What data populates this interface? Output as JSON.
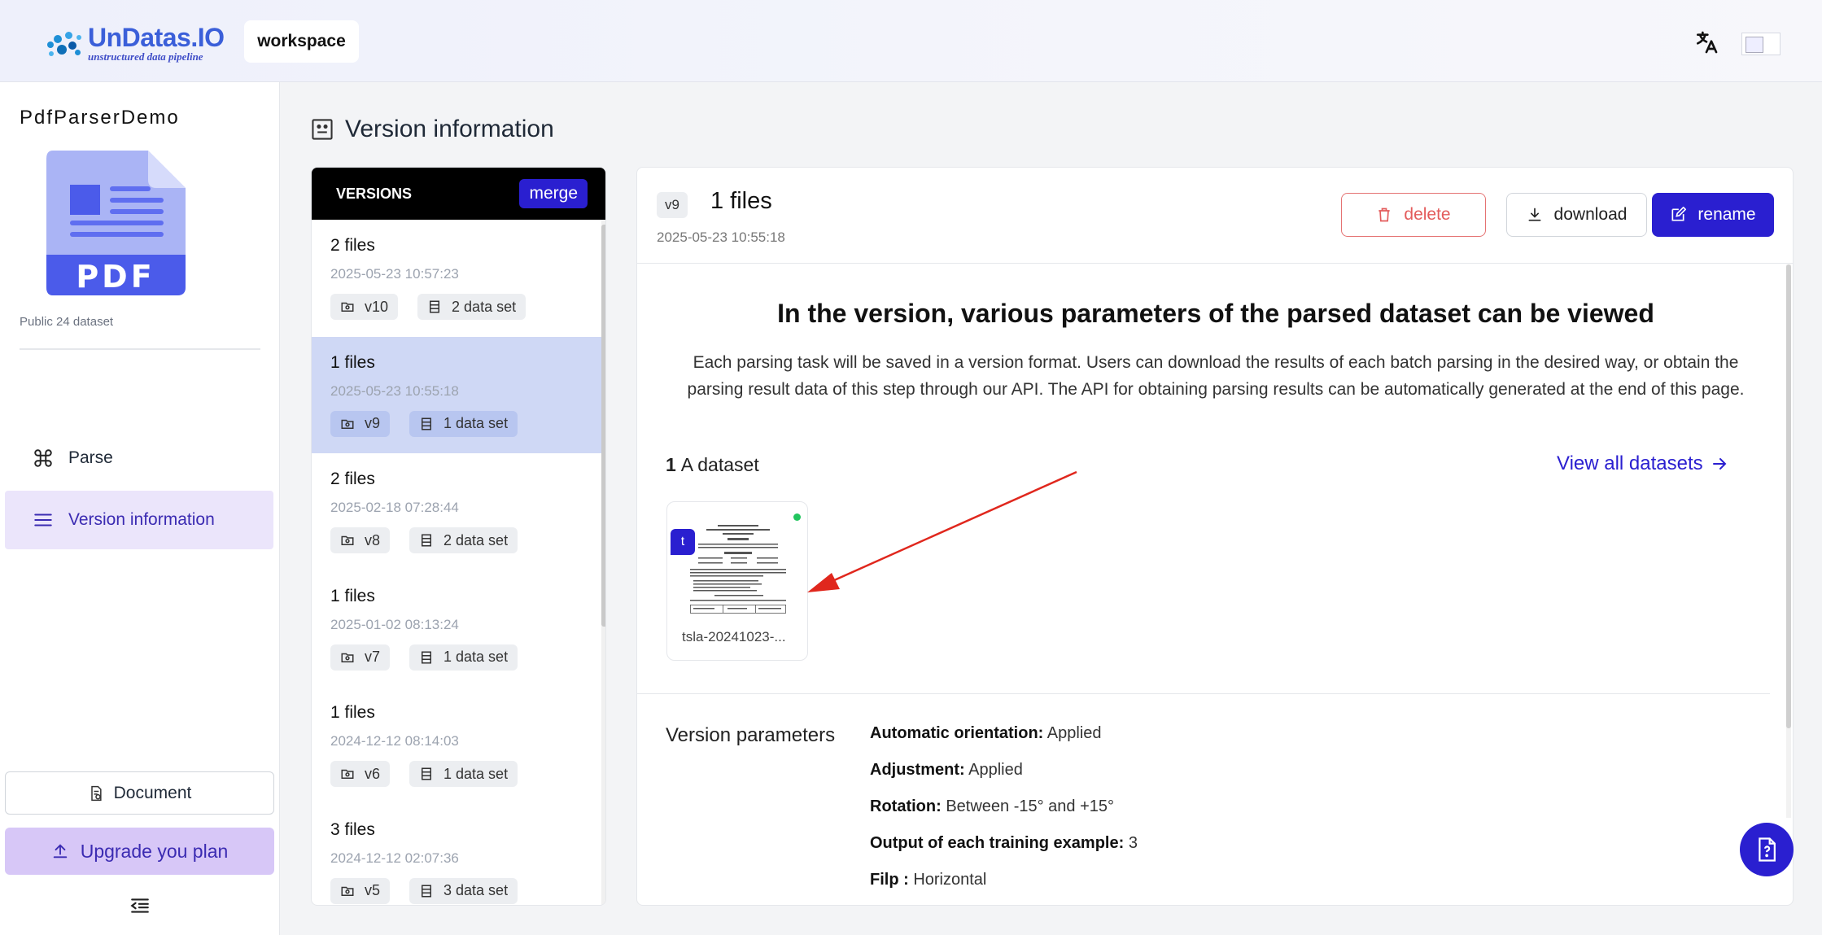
{
  "header": {
    "logo_title": "UnDatas.IO",
    "logo_subtitle": "unstructured data pipeline",
    "workspace_label": "workspace"
  },
  "sidebar": {
    "project_name": "PdfParserDemo",
    "pdf_label": "PDF",
    "public_text": "Public 24 dataset",
    "nav": [
      {
        "label": "Parse",
        "icon": "command-icon"
      },
      {
        "label": "Version information",
        "icon": "menu-icon",
        "active": true
      }
    ],
    "document_label": "Document",
    "upgrade_label": "Upgrade you plan"
  },
  "page": {
    "title": "Version information"
  },
  "versions": {
    "header_label": "VERSIONS",
    "merge_label": "merge",
    "items": [
      {
        "files": "2 files",
        "date": "2025-05-23 10:57:23",
        "version": "v10",
        "datasets": "2 data set",
        "selected": false
      },
      {
        "files": "1 files",
        "date": "2025-05-23 10:55:18",
        "version": "v9",
        "datasets": "1 data set",
        "selected": true
      },
      {
        "files": "2 files",
        "date": "2025-02-18 07:28:44",
        "version": "v8",
        "datasets": "2 data set",
        "selected": false
      },
      {
        "files": "1 files",
        "date": "2025-01-02 08:13:24",
        "version": "v7",
        "datasets": "1 data set",
        "selected": false
      },
      {
        "files": "1 files",
        "date": "2024-12-12 08:14:03",
        "version": "v6",
        "datasets": "1 data set",
        "selected": false
      },
      {
        "files": "3 files",
        "date": "2024-12-12 02:07:36",
        "version": "v5",
        "datasets": "3 data set",
        "selected": false
      }
    ]
  },
  "detail": {
    "version_badge": "v9",
    "files": "1 files",
    "date": "2025-05-23 10:55:18",
    "delete_label": "delete",
    "download_label": "download",
    "rename_label": "rename",
    "heading": "In the version, various parameters of the parsed dataset can be viewed",
    "description": "Each parsing task will be saved in a version format. Users can download the results of each batch parsing in the desired way, or obtain the parsing result data of this step through our API. The API for obtaining parsing results can be automatically generated at the end of this page.",
    "dataset_count": "1",
    "dataset_label": "A dataset",
    "view_all_label": "View all datasets",
    "dataset_card": {
      "badge": "t",
      "name": "tsla-20241023-..."
    },
    "params_title": "Version parameters",
    "params": [
      {
        "key": "Automatic orientation:",
        "value": " Applied"
      },
      {
        "key": "Adjustment:",
        "value": " Applied"
      },
      {
        "key": "Rotation:",
        "value": " Between -15° and +15°"
      },
      {
        "key": "Output of each training example:",
        "value": " 3"
      },
      {
        "key": "Filp :",
        "value": " Horizontal"
      }
    ]
  },
  "colors": {
    "accent": "#2a1fd0",
    "selected_row": "#cfd8f5",
    "active_nav": "#ebe5fb",
    "upgrade_bg": "#d7c7f7",
    "delete": "#e35b5b",
    "status_dot": "#22c55e",
    "annotation_arrow": "#e0271d"
  }
}
